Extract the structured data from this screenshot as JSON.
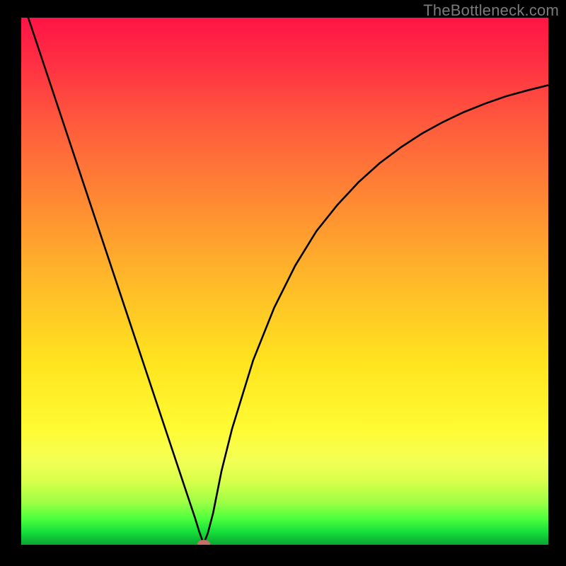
{
  "watermark": "TheBottleneck.com",
  "chart_data": {
    "type": "line",
    "title": "",
    "xlabel": "",
    "ylabel": "",
    "xlim": [
      0,
      100
    ],
    "ylim": [
      0,
      100
    ],
    "grid": false,
    "legend": false,
    "series": [
      {
        "name": "curve",
        "x": [
          0,
          4,
          8,
          12,
          16,
          20,
          24,
          26,
          28,
          30,
          31,
          32,
          33,
          33.8,
          34.6,
          35.4,
          36.4,
          38,
          40,
          44,
          48,
          52,
          56,
          60,
          64,
          68,
          72,
          76,
          80,
          84,
          88,
          92,
          96,
          100
        ],
        "y": [
          104,
          92,
          80,
          68,
          56,
          44,
          32,
          26,
          20,
          14,
          11,
          8,
          5,
          2.4,
          0.2,
          2.2,
          6.0,
          14,
          22,
          35,
          45,
          53,
          59.5,
          64.5,
          68.8,
          72.4,
          75.4,
          78.0,
          80.2,
          82.1,
          83.7,
          85.1,
          86.2,
          87.2
        ]
      }
    ],
    "annotations": [
      {
        "name": "min-dot",
        "x": 34.6,
        "y": 0.2
      }
    ],
    "background_gradient": {
      "direction": "vertical",
      "stops": [
        {
          "pos": 0.0,
          "color": "#ff1445"
        },
        {
          "pos": 0.35,
          "color": "#ff8a33"
        },
        {
          "pos": 0.65,
          "color": "#ffe31f"
        },
        {
          "pos": 0.88,
          "color": "#d8ff4a"
        },
        {
          "pos": 1.0,
          "color": "#0aa530"
        }
      ]
    }
  }
}
